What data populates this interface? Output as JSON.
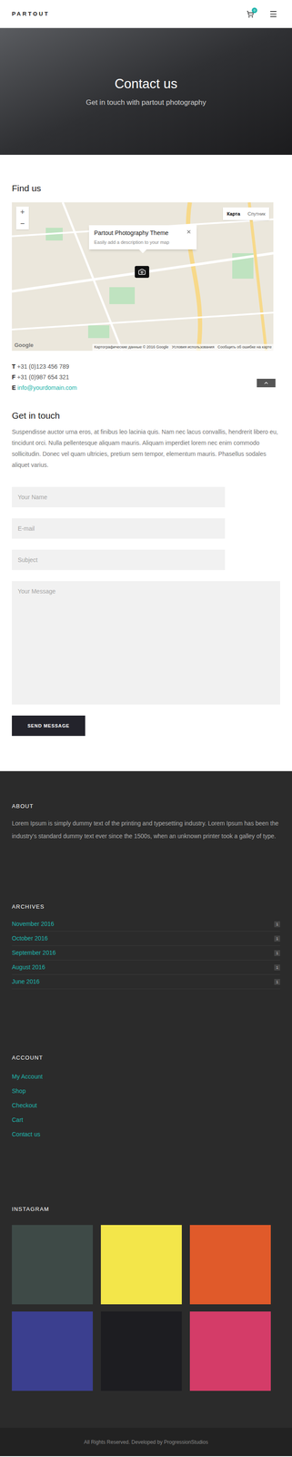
{
  "header": {
    "logo": "PARTOUT",
    "cart_count": "0"
  },
  "hero": {
    "title": "Contact us",
    "subtitle": "Get in touch with partout photography"
  },
  "find_us": {
    "heading": "Find us",
    "map": {
      "popup_title": "Partout Photography Theme",
      "popup_text": "Easily add a description to your map",
      "zoom": [
        "+",
        "−"
      ],
      "map_types": [
        {
          "label": "Карта",
          "selected": true
        },
        {
          "label": "Спутник",
          "selected": false
        }
      ],
      "logo": "Google",
      "attribution": [
        "Картографические данные © 2016 Google",
        "Условия использования",
        "Сообщить об ошибке на карте"
      ]
    },
    "contact": [
      {
        "label": "T",
        "value": "+31 (0)123 456 789",
        "link": false
      },
      {
        "label": "F",
        "value": "+31 (0)987 654 321",
        "link": false
      },
      {
        "label": "E",
        "value": "info@yourdomain.com",
        "link": true
      }
    ]
  },
  "get_in_touch": {
    "heading": "Get in touch",
    "text": "Suspendisse auctor urna eros, at finibus leo lacinia quis. Nam nec lacus convallis, hendrerit libero eu, tincidunt orci. Nulla pellentesque aliquam mauris. Aliquam imperdiet lorem nec enim commodo sollicitudin. Donec vel quam ultricies, pretium sem tempor, elementum mauris. Phasellus sodales aliquet varius.",
    "fields": [
      "Your Name",
      "E-mail",
      "Subject"
    ],
    "message_placeholder": "Your Message",
    "button": "SEND MESSAGE"
  },
  "footer": {
    "about": {
      "heading": "ABOUT",
      "text": "Lorem Ipsum is simply dummy text of the printing and typesetting industry. Lorem Ipsum has been the industry's standard dummy text ever since the 1500s, when an unknown printer took a galley of type."
    },
    "archives": {
      "heading": "ARCHIVES",
      "items": [
        {
          "label": "November 2016",
          "count": "1"
        },
        {
          "label": "October 2016",
          "count": "1"
        },
        {
          "label": "September 2016",
          "count": "1"
        },
        {
          "label": "August 2016",
          "count": "1"
        },
        {
          "label": "June 2016",
          "count": "1"
        }
      ]
    },
    "account": {
      "heading": "ACCOUNT",
      "links": [
        "My Account",
        "Shop",
        "Checkout",
        "Cart",
        "Contact us"
      ]
    },
    "instagram": {
      "heading": "INSTAGRAM",
      "tiles": [
        {
          "color": "#3e4a47"
        },
        {
          "color": "#f3e64a"
        },
        {
          "color": "#e05a2a"
        },
        {
          "color": "#3b3f8f"
        },
        {
          "color": "#1d1d21"
        },
        {
          "color": "#d43c68"
        }
      ]
    },
    "copyright": "All Rights Reserved. Developed by ProgressionStudios"
  }
}
